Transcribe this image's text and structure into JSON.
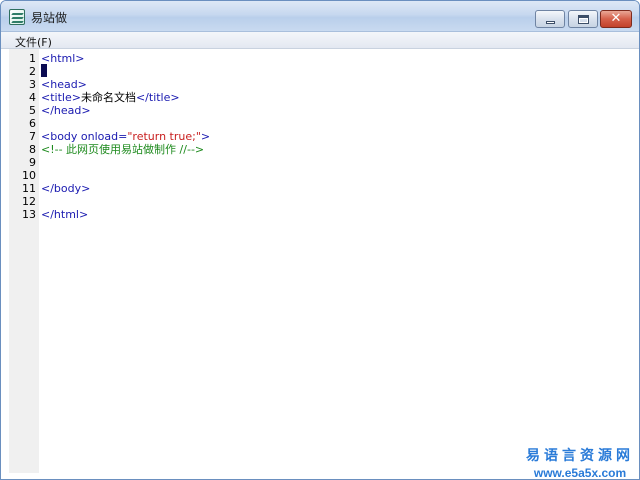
{
  "window": {
    "title": "易站做"
  },
  "menubar": {
    "items": [
      {
        "label": "文件(F)"
      }
    ]
  },
  "editor": {
    "line_numbers": [
      "1",
      "2",
      "3",
      "4",
      "5",
      "6",
      "7",
      "8",
      "9",
      "10",
      "11",
      "12",
      "13"
    ],
    "lines": [
      {
        "segments": [
          {
            "t": "<html>",
            "c": "tag"
          }
        ]
      },
      {
        "segments": []
      },
      {
        "segments": [
          {
            "t": "<head>",
            "c": "tag"
          }
        ]
      },
      {
        "segments": [
          {
            "t": "<title>",
            "c": "tag"
          },
          {
            "t": "未命名文档",
            "c": "text"
          },
          {
            "t": "</title>",
            "c": "tag"
          }
        ]
      },
      {
        "segments": [
          {
            "t": "</head>",
            "c": "tag"
          }
        ]
      },
      {
        "segments": []
      },
      {
        "segments": [
          {
            "t": "<body onload=",
            "c": "tag"
          },
          {
            "t": "\"return true;\"",
            "c": "attr-val"
          },
          {
            "t": ">",
            "c": "tag"
          }
        ]
      },
      {
        "segments": [
          {
            "t": "<!-- 此网页使用易站做制作 //-->",
            "c": "comment"
          }
        ]
      },
      {
        "segments": []
      },
      {
        "segments": []
      },
      {
        "segments": [
          {
            "t": "</body>",
            "c": "tag"
          }
        ]
      },
      {
        "segments": []
      },
      {
        "segments": [
          {
            "t": "</html>",
            "c": "tag"
          }
        ]
      }
    ]
  },
  "watermark": {
    "line1": "易语言资源网",
    "line2": "www.e5a5x.com"
  },
  "colors": {
    "tag": "#1a1ab0",
    "attr_value": "#c81e1e",
    "comment": "#1d8a1d",
    "watermark": "#2a7bd8"
  }
}
